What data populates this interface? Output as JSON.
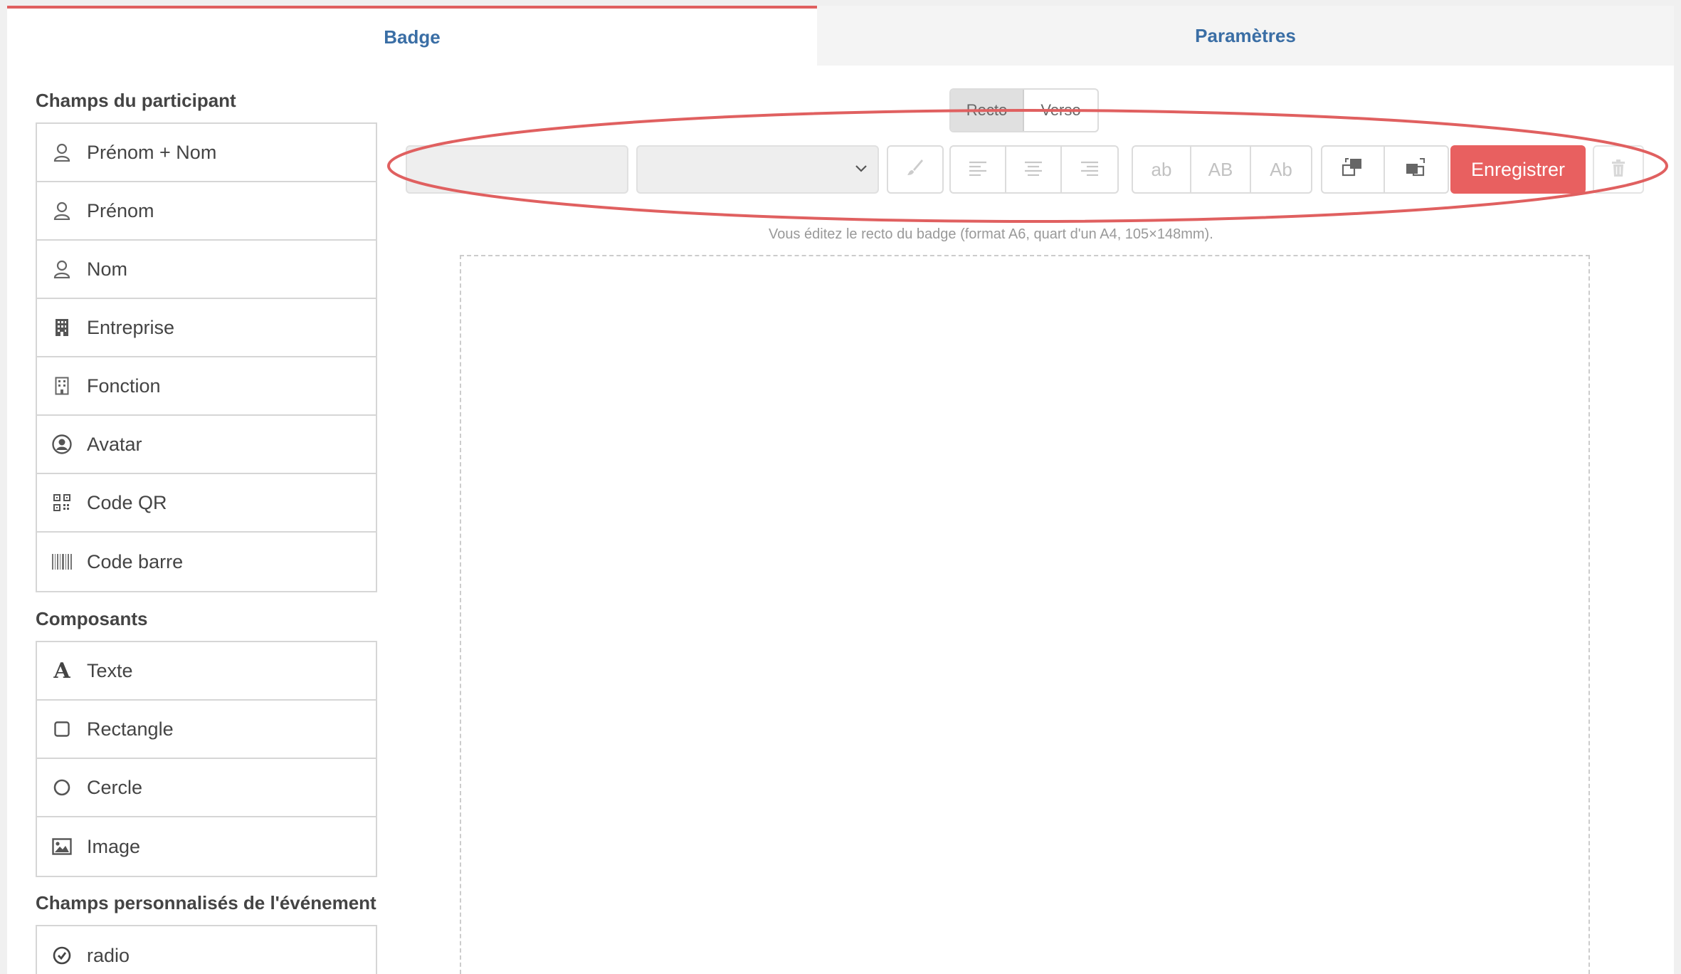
{
  "tabs": [
    {
      "label": "Badge",
      "active": true
    },
    {
      "label": "Paramètres",
      "active": false
    }
  ],
  "sidebar": {
    "participant_title": "Champs du participant",
    "participant_fields": [
      {
        "label": "Prénom + Nom",
        "icon": "user-icon"
      },
      {
        "label": "Prénom",
        "icon": "user-icon"
      },
      {
        "label": "Nom",
        "icon": "user-icon"
      },
      {
        "label": "Entreprise",
        "icon": "building-icon"
      },
      {
        "label": "Fonction",
        "icon": "building-outline-icon"
      },
      {
        "label": "Avatar",
        "icon": "avatar-icon"
      },
      {
        "label": "Code QR",
        "icon": "qr-code-icon"
      },
      {
        "label": "Code barre",
        "icon": "barcode-icon"
      }
    ],
    "components_title": "Composants",
    "components": [
      {
        "label": "Texte",
        "icon": "text-icon"
      },
      {
        "label": "Rectangle",
        "icon": "rectangle-icon"
      },
      {
        "label": "Cercle",
        "icon": "circle-icon"
      },
      {
        "label": "Image",
        "icon": "image-icon"
      }
    ],
    "custom_title": "Champs personnalisés de l'événement",
    "custom_fields": [
      {
        "label": "radio",
        "icon": "check-circle-icon"
      }
    ]
  },
  "side_toggle": {
    "recto": "Recto",
    "verso": "Verso",
    "selected": "Recto"
  },
  "toolbar": {
    "font_input_value": "",
    "size_select_value": "",
    "case_buttons": [
      "ab",
      "AB",
      "Ab"
    ],
    "save_label": "Enregistrer",
    "colors": {
      "accent": "#e86060",
      "tab_text": "#3a6ea5",
      "annotation": "#e06060"
    }
  },
  "editor": {
    "info": "Vous éditez le recto du badge (format A6, quart d'un A4, 105×148mm)."
  }
}
